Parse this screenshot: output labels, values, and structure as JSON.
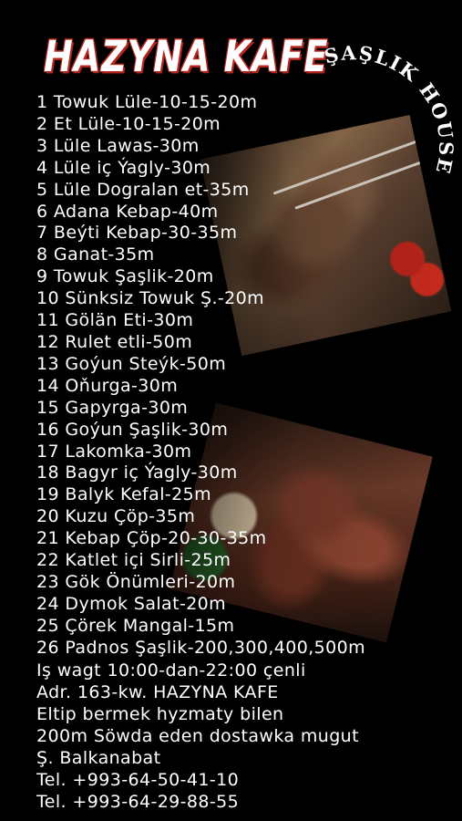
{
  "title": "HAZYNA KAFE",
  "subtitle": "ŞAŞLIK HOUSE",
  "menu": [
    "1 Towuk Lüle-10-15-20m",
    "2 Et Lüle-10-15-20m",
    "3 Lüle Lawas-30m",
    "4 Lüle iç Ýagly-30m",
    "5 Lüle Dogralan et-35m",
    "6 Adana Kebap-40m",
    "7 Beýti Kebap-30-35m",
    "8 Ganat-35m",
    "9 Towuk Şaşlik-20m",
    "10 Sünksiz Towuk Ş.-20m",
    "11 Gölän Eti-30m",
    "12 Rulet etli-50m",
    "13 Goýun Steýk-50m",
    "14 Oňurga-30m",
    "15 Gapyrga-30m",
    "16 Goýun Şaşlik-30m",
    "17 Lakomka-30m",
    "18 Bagyr iç Ýagly-30m",
    "19 Balyk Kefal-25m",
    "20 Kuzu Çöp-35m",
    "21 Kebap Çöp-20-30-35m",
    "22 Katlet içi Sirli-25m",
    "23 Gök Önümleri-20m",
    "24 Dymok Salat-20m",
    "25 Çörek Mangal-15m",
    "26 Padnos Şaşlik-200,300,400,500m"
  ],
  "info": [
    "Iş wagt 10:00-dan-22:00 çenli",
    "Adr. 163-kw. HAZYNA KAFE",
    "Eltip bermek hyzmaty bilen",
    "200m Söwda eden dostawka mugut",
    "Ş. Balkanabat",
    "Tel. +993-64-50-41-10",
    "Tel. +993-64-29-88-55"
  ],
  "colors": {
    "background": "#000000",
    "text": "#ffffff",
    "title_outline": "#b3261e"
  }
}
